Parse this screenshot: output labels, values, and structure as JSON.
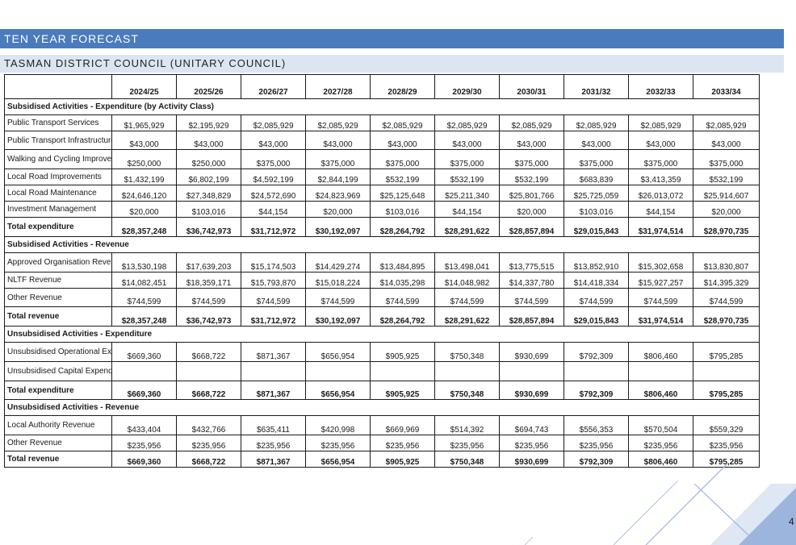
{
  "header": {
    "title": "TEN YEAR FORECAST",
    "subtitle": "TASMAN DISTRICT COUNCIL (UNITARY COUNCIL)"
  },
  "columns": [
    "2024/25",
    "2025/26",
    "2026/27",
    "2027/28",
    "2028/29",
    "2029/30",
    "2030/31",
    "2031/32",
    "2032/33",
    "2033/34"
  ],
  "sections": [
    {
      "heading": "Subsidised Activities - Expenditure (by Activity Class)",
      "rows": [
        {
          "label": "Public Transport Services",
          "values": [
            "$1,965,929",
            "$2,195,929",
            "$2,085,929",
            "$2,085,929",
            "$2,085,929",
            "$2,085,929",
            "$2,085,929",
            "$2,085,929",
            "$2,085,929",
            "$2,085,929"
          ]
        },
        {
          "label": "Public Transport Infrastructure",
          "values": [
            "$43,000",
            "$43,000",
            "$43,000",
            "$43,000",
            "$43,000",
            "$43,000",
            "$43,000",
            "$43,000",
            "$43,000",
            "$43,000"
          ]
        },
        {
          "label": "Walking and Cycling Improvements",
          "values": [
            "$250,000",
            "$250,000",
            "$375,000",
            "$375,000",
            "$375,000",
            "$375,000",
            "$375,000",
            "$375,000",
            "$375,000",
            "$375,000"
          ]
        },
        {
          "label": "Local Road Improvements",
          "values": [
            "$1,432,199",
            "$6,802,199",
            "$4,592,199",
            "$2,844,199",
            "$532,199",
            "$532,199",
            "$532,199",
            "$683,839",
            "$3,413,359",
            "$532,199"
          ]
        },
        {
          "label": "Local Road Maintenance",
          "values": [
            "$24,646,120",
            "$27,348,829",
            "$24,572,690",
            "$24,823,969",
            "$25,125,648",
            "$25,211,340",
            "$25,801,766",
            "$25,725,059",
            "$26,013,072",
            "$25,914,607"
          ]
        },
        {
          "label": "Investment Management",
          "values": [
            "$20,000",
            "$103,016",
            "$44,154",
            "$20,000",
            "$103,016",
            "$44,154",
            "$20,000",
            "$103,016",
            "$44,154",
            "$20,000"
          ]
        },
        {
          "label": "Total expenditure",
          "total": true,
          "values": [
            "$28,357,248",
            "$36,742,973",
            "$31,712,972",
            "$30,192,097",
            "$28,264,792",
            "$28,291,622",
            "$28,857,894",
            "$29,015,843",
            "$31,974,514",
            "$28,970,735"
          ]
        }
      ]
    },
    {
      "heading": "Subsidised Activities - Revenue",
      "rows": [
        {
          "label": "Approved Organisation Revenue",
          "values": [
            "$13,530,198",
            "$17,639,203",
            "$15,174,503",
            "$14,429,274",
            "$13,484,895",
            "$13,498,041",
            "$13,775,515",
            "$13,852,910",
            "$15,302,658",
            "$13,830,807"
          ]
        },
        {
          "label": "NLTF Revenue",
          "values": [
            "$14,082,451",
            "$18,359,171",
            "$15,793,870",
            "$15,018,224",
            "$14,035,298",
            "$14,048,982",
            "$14,337,780",
            "$14,418,334",
            "$15,927,257",
            "$14,395,329"
          ]
        },
        {
          "label": "Other Revenue",
          "values": [
            "$744,599",
            "$744,599",
            "$744,599",
            "$744,599",
            "$744,599",
            "$744,599",
            "$744,599",
            "$744,599",
            "$744,599",
            "$744,599"
          ]
        },
        {
          "label": "Total revenue",
          "total": true,
          "values": [
            "$28,357,248",
            "$36,742,973",
            "$31,712,972",
            "$30,192,097",
            "$28,264,792",
            "$28,291,622",
            "$28,857,894",
            "$29,015,843",
            "$31,974,514",
            "$28,970,735"
          ]
        }
      ]
    },
    {
      "heading": "Unsubsidised Activities - Expenditure",
      "rows": [
        {
          "label": "Unsubsidised Operational Expenditure",
          "values": [
            "$669,360",
            "$668,722",
            "$871,367",
            "$656,954",
            "$905,925",
            "$750,348",
            "$930,699",
            "$792,309",
            "$806,460",
            "$795,285"
          ]
        },
        {
          "label": "Unsubsidised Capital Expenditure",
          "values": [
            "",
            "",
            "",
            "",
            "",
            "",
            "",
            "",
            "",
            ""
          ]
        },
        {
          "label": "Total expenditure",
          "total": true,
          "values": [
            "$669,360",
            "$668,722",
            "$871,367",
            "$656,954",
            "$905,925",
            "$750,348",
            "$930,699",
            "$792,309",
            "$806,460",
            "$795,285"
          ]
        }
      ]
    },
    {
      "heading": "Unsubsidised Activities - Revenue",
      "rows": [
        {
          "label": "Local Authority Revenue",
          "values": [
            "$433,404",
            "$432,766",
            "$635,411",
            "$420,998",
            "$669,969",
            "$514,392",
            "$694,743",
            "$556,353",
            "$570,504",
            "$559,329"
          ]
        },
        {
          "label": "Other Revenue",
          "values": [
            "$235,956",
            "$235,956",
            "$235,956",
            "$235,956",
            "$235,956",
            "$235,956",
            "$235,956",
            "$235,956",
            "$235,956",
            "$235,956"
          ]
        },
        {
          "label": "Total revenue",
          "total": true,
          "values": [
            "$669,360",
            "$668,722",
            "$871,367",
            "$656,954",
            "$905,925",
            "$750,348",
            "$930,699",
            "$792,309",
            "$806,460",
            "$795,285"
          ]
        }
      ]
    }
  ],
  "page_number": "4",
  "colors": {
    "title_bar": "#4a7bbd",
    "subtitle_bar": "#dce6f2",
    "section_bg": "#ffffff"
  }
}
